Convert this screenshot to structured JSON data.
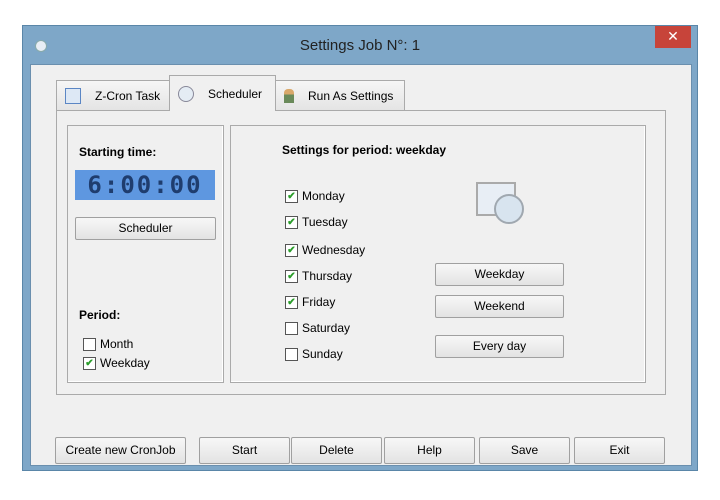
{
  "window": {
    "title": "Settings Job N°: 1",
    "close": "✕"
  },
  "tabs": [
    {
      "label": "Z-Cron Task"
    },
    {
      "label": "Scheduler"
    },
    {
      "label": "Run As Settings"
    }
  ],
  "left": {
    "starting_label": "Starting time:",
    "time": "6:00:00",
    "scheduler_button": "Scheduler",
    "period_label": "Period:",
    "periods": [
      {
        "label": "Month",
        "checked": false
      },
      {
        "label": "Weekday",
        "checked": true
      }
    ]
  },
  "right": {
    "heading": "Settings for period: weekday",
    "days": [
      {
        "label": "Monday",
        "checked": true
      },
      {
        "label": "Tuesday",
        "checked": true
      },
      {
        "label": "Wednesday",
        "checked": true
      },
      {
        "label": "Thursday",
        "checked": true
      },
      {
        "label": "Friday",
        "checked": true
      },
      {
        "label": "Saturday",
        "checked": false
      },
      {
        "label": "Sunday",
        "checked": false
      }
    ],
    "buttons": {
      "weekday": "Weekday",
      "weekend": "Weekend",
      "everyday": "Every day"
    }
  },
  "footer": {
    "create": "Create new CronJob",
    "start": "Start",
    "delete": "Delete",
    "help": "Help",
    "save": "Save",
    "exit": "Exit"
  },
  "check_mark": "✔"
}
